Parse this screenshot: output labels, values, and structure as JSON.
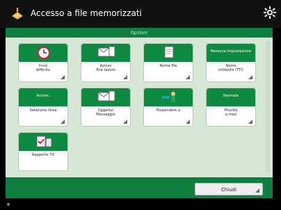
{
  "header": {
    "title": "Accesso a file memorizzati"
  },
  "subheader": {
    "title": "Opzioni"
  },
  "tiles": [
    {
      "id": "invio-differito",
      "top_text": "",
      "icon": "clock-icon",
      "label_line1": "Invio",
      "label_line2": "differito"
    },
    {
      "id": "avviso-fine-lavoro",
      "top_text": "",
      "icon": "document-envelope-icon",
      "label_line1": "Avviso",
      "label_line2": "fine lavoro"
    },
    {
      "id": "nome-file",
      "top_text": "",
      "icon": "file-icon",
      "label_line1": "Nome file",
      "label_line2": ""
    },
    {
      "id": "nome-mittente",
      "top_text": "Nessuna impostazione",
      "icon": "",
      "label_line1": "Nome",
      "label_line2": "mittente (TTI)"
    },
    {
      "id": "selezione-linea",
      "top_text": "Autom.",
      "icon": "",
      "label_line1": "Selezione linea",
      "label_line2": ""
    },
    {
      "id": "oggetto-messaggio",
      "top_text": "",
      "icon": "document-envelope-icon",
      "label_line1": "Oggetto/",
      "label_line2": "Messaggio"
    },
    {
      "id": "rispondere-a",
      "top_text": "",
      "icon": "person-arrow-icon",
      "label_line1": "Rispondere a",
      "label_line2": ""
    },
    {
      "id": "priorita-email",
      "top_text": "Normale",
      "icon": "",
      "label_line1": "Priorità",
      "label_line2": "e-mail"
    },
    {
      "id": "rapporto-tx",
      "top_text": "",
      "icon": "report-tx-icon",
      "label_line1": "Rapporto TX",
      "label_line2": ""
    }
  ],
  "footer": {
    "close_label": "Chiudi"
  }
}
